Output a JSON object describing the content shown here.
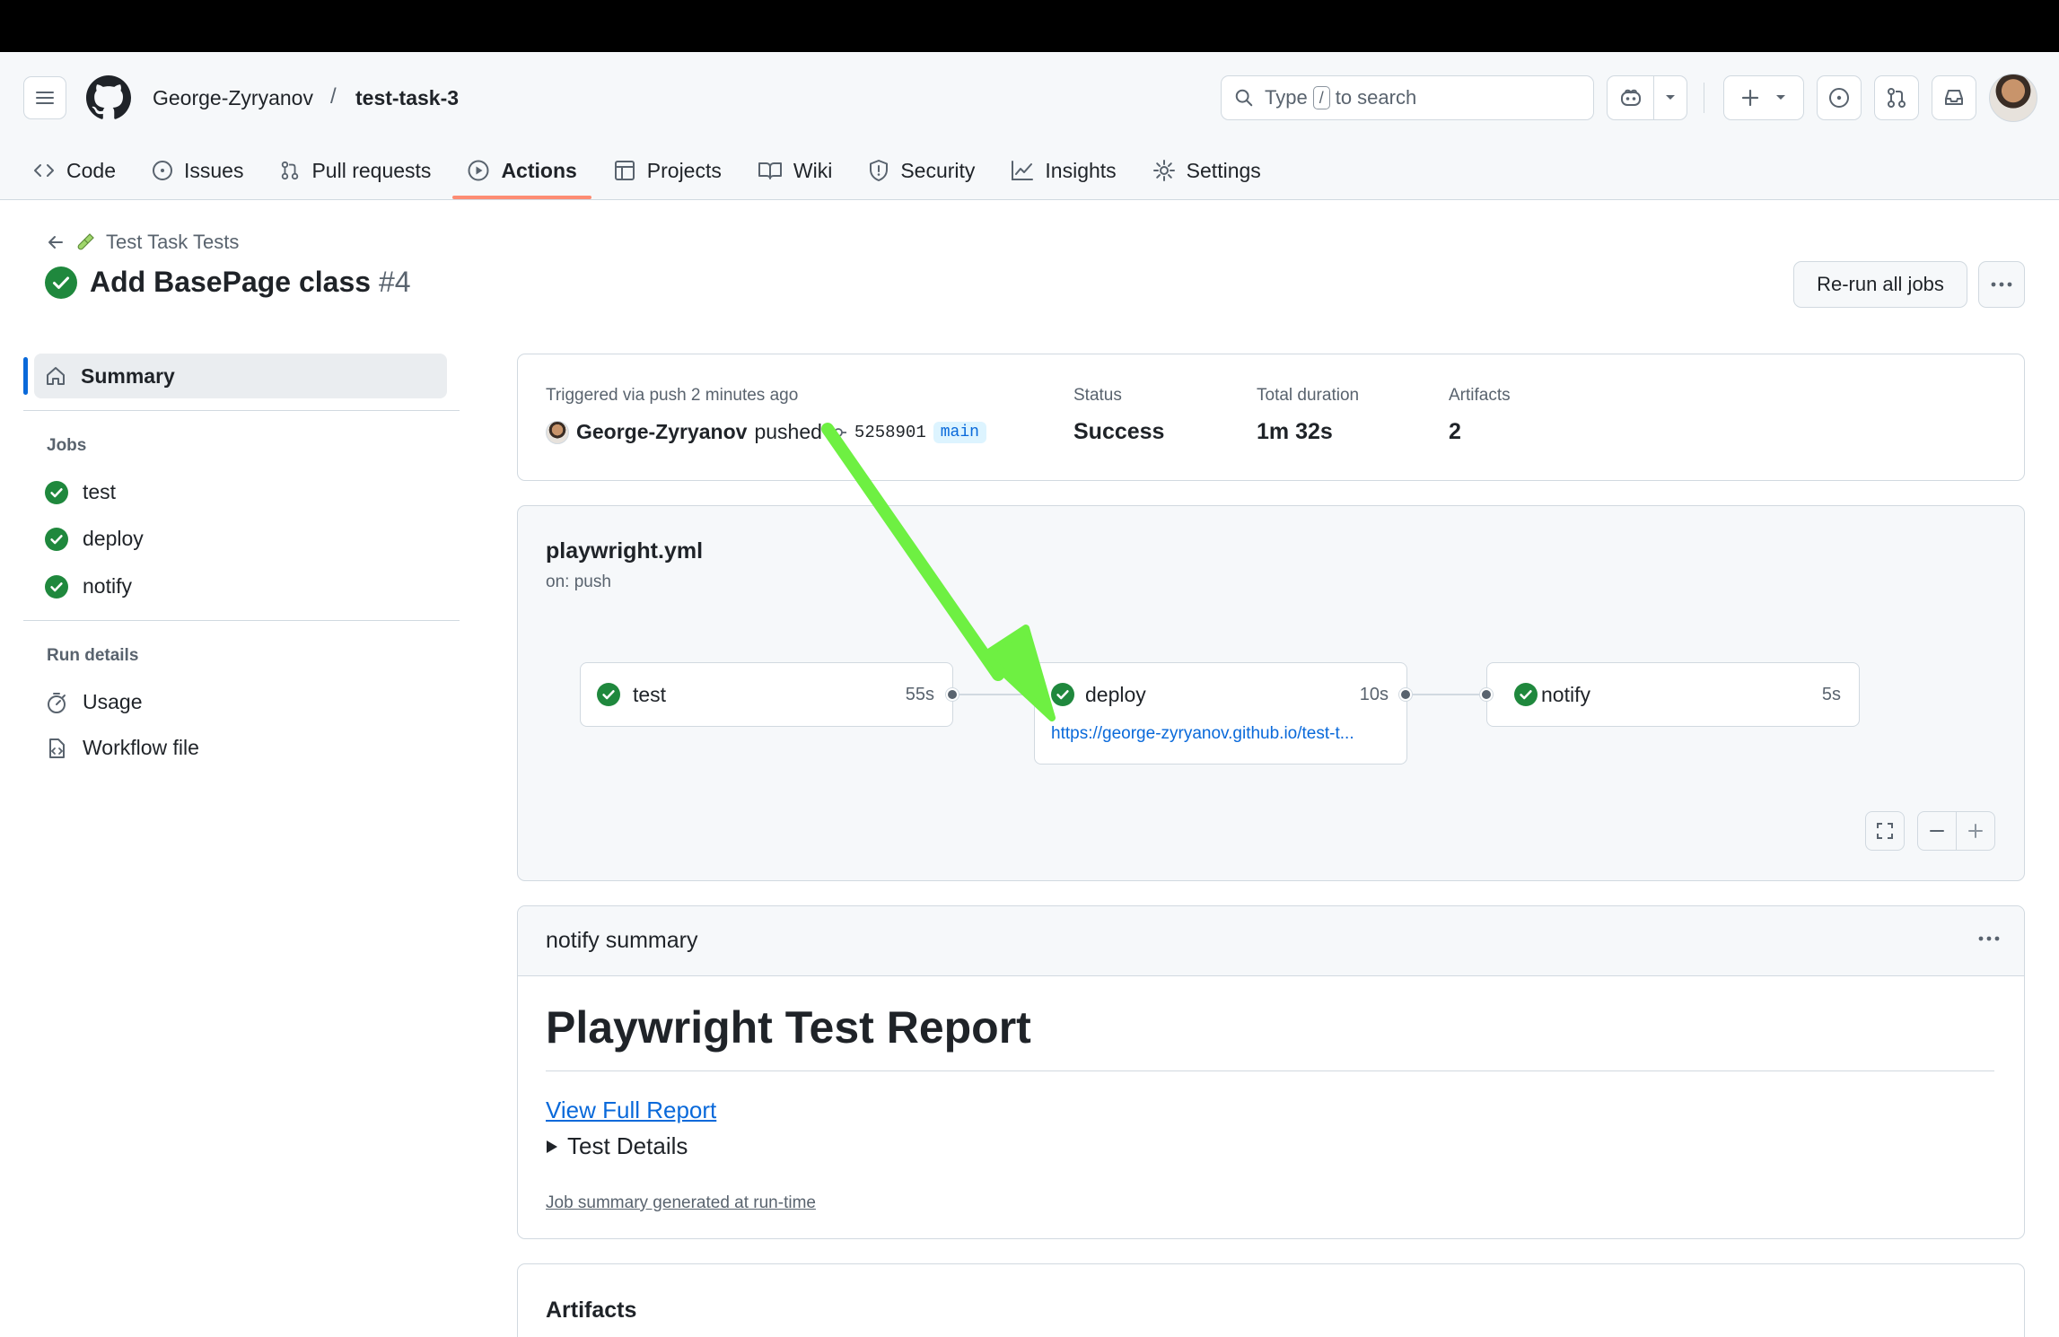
{
  "header": {
    "owner": "George-Zyryanov",
    "separator": "/",
    "repo": "test-task-3",
    "search": {
      "prefix": "Type",
      "key": "/",
      "suffix": "to search"
    }
  },
  "tabs": [
    {
      "label": "Code",
      "icon": "code-icon"
    },
    {
      "label": "Issues",
      "icon": "issue-icon"
    },
    {
      "label": "Pull requests",
      "icon": "pull-request-icon"
    },
    {
      "label": "Actions",
      "icon": "play-icon",
      "active": true
    },
    {
      "label": "Projects",
      "icon": "table-icon"
    },
    {
      "label": "Wiki",
      "icon": "book-icon"
    },
    {
      "label": "Security",
      "icon": "shield-icon"
    },
    {
      "label": "Insights",
      "icon": "graph-icon"
    },
    {
      "label": "Settings",
      "icon": "gear-icon"
    }
  ],
  "run": {
    "workflow_link": "Test Task Tests",
    "title": "Add BasePage class",
    "number": "#4",
    "rerun_label": "Re-run all jobs"
  },
  "sidebar": {
    "summary_label": "Summary",
    "jobs_heading": "Jobs",
    "jobs": [
      "test",
      "deploy",
      "notify"
    ],
    "run_details_heading": "Run details",
    "details": [
      {
        "label": "Usage",
        "icon": "stopwatch-icon"
      },
      {
        "label": "Workflow file",
        "icon": "file-code-icon"
      }
    ]
  },
  "trigger": {
    "label": "Triggered via push 2 minutes ago",
    "actor": "George-Zyryanov",
    "action": "pushed",
    "sha": "5258901",
    "branch": "main",
    "status_label": "Status",
    "status_value": "Success",
    "duration_label": "Total duration",
    "duration_value": "1m 32s",
    "artifacts_label": "Artifacts",
    "artifacts_value": "2"
  },
  "workflow": {
    "file": "playwright.yml",
    "on": "on: push",
    "jobs": [
      {
        "name": "test",
        "time": "55s"
      },
      {
        "name": "deploy",
        "time": "10s",
        "url": "https://george-zyryanov.github.io/test-t..."
      },
      {
        "name": "notify",
        "time": "5s"
      }
    ]
  },
  "summary": {
    "heading": "notify summary",
    "report_title": "Playwright Test Report",
    "full_report_link": "View Full Report",
    "details_label": "Test Details",
    "generated_note": "Job summary generated at run-time"
  },
  "artifacts": {
    "heading": "Artifacts"
  },
  "colors": {
    "success": "#1f883d",
    "link": "#0969da",
    "active_tab_underline": "#fd8c73",
    "annotation_arrow": "#6ef042"
  }
}
